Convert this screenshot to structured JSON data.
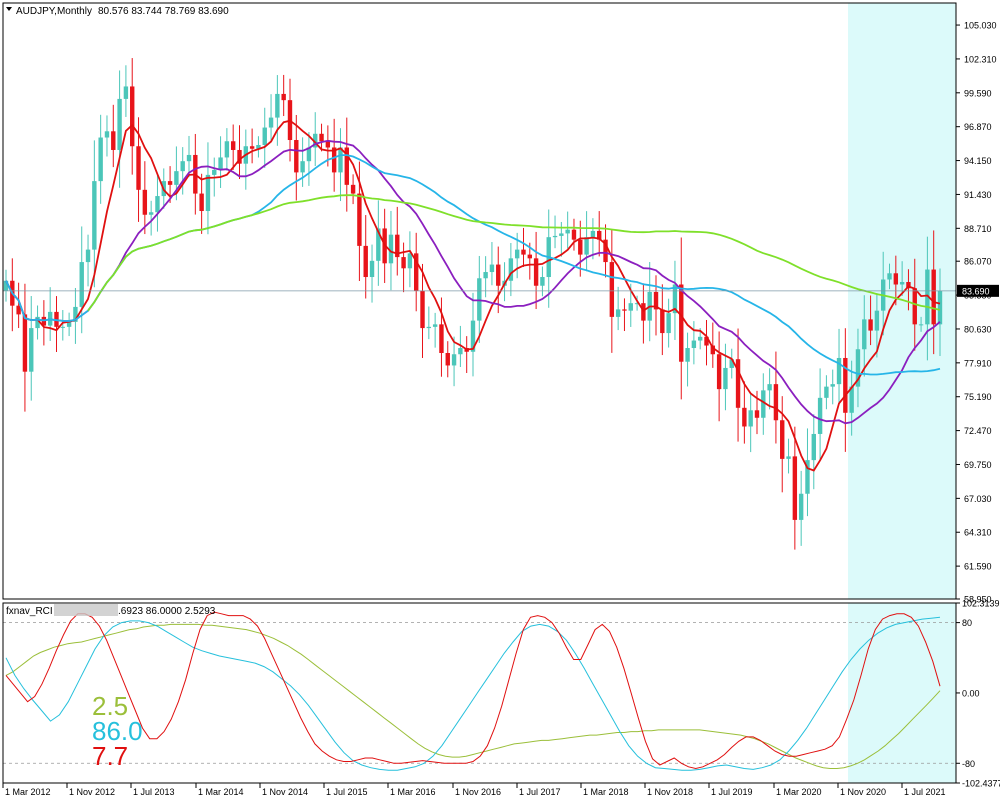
{
  "window": {
    "symbol_title": "AUDJPY,Monthly",
    "ohlc_text": "80.576 83.744 78.769 83.690",
    "indicator_label": "fxnav_RCI",
    "indicator_values_text": ".6923 86.0000 2.5293"
  },
  "colors": {
    "bull": "#4bc6b9",
    "bear": "#e8141a",
    "ma_fast": "#e01010",
    "ma_mid": "#8b1fbf",
    "ma_slow": "#26b5e8",
    "ma_long": "#7fe02a",
    "rci_short": "#e01010",
    "rci_mid": "#26c0dc",
    "rci_long": "#9bbf3a",
    "highlight": "#dcfafa",
    "current_line": "#7f9aa8"
  },
  "chart_data": [
    {
      "type": "candlestick",
      "title": "AUDJPY,Monthly",
      "ylim": [
        58.95,
        106.8
      ],
      "y_ticks": [
        "105.030",
        "102.310",
        "99.590",
        "96.870",
        "94.150",
        "91.430",
        "88.710",
        "86.070",
        "83.350",
        "80.630",
        "77.910",
        "75.190",
        "72.470",
        "69.750",
        "67.030",
        "64.310",
        "61.590",
        "58.950"
      ],
      "x_ticks": [
        "1 Mar 2012",
        "1 Nov 2012",
        "1 Jul 2013",
        "1 Mar 2014",
        "1 Nov 2014",
        "1 Jul 2015",
        "1 Mar 2016",
        "1 Nov 2016",
        "1 Jul 2017",
        "1 Mar 2018",
        "1 Nov 2018",
        "1 Jul 2019",
        "1 Mar 2020",
        "1 Nov 2020",
        "1 Jul 2021"
      ],
      "current_price": "83.690",
      "close": [
        84.5,
        82.5,
        81.8,
        77.2,
        80.7,
        81.6,
        80.9,
        82.0,
        80.8,
        80.8,
        81.2,
        82.4,
        86.0,
        87.0,
        92.5,
        96.0,
        96.5,
        95.0,
        99.1,
        100.1,
        95.3,
        91.8,
        89.8,
        90.0,
        91.3,
        92.5,
        92.2,
        93.3,
        94.1,
        94.6,
        91.5,
        90.1,
        93.0,
        93.4,
        94.4,
        95.7,
        95.0,
        93.9,
        95.3,
        95.1,
        95.4,
        96.8,
        97.6,
        99.5,
        99.0,
        95.8,
        93.2,
        94.1,
        95.2,
        96.3,
        95.7,
        95.2,
        93.2,
        95.2,
        92.2,
        91.5,
        87.3,
        84.8,
        86.1,
        88.7,
        85.9,
        88.2,
        86.4,
        85.5,
        86.7,
        83.7,
        80.7,
        80.8,
        81.0,
        78.7,
        77.7,
        78.6,
        79.1,
        78.8,
        81.3,
        84.7,
        85.2,
        85.8,
        84.1,
        84.5,
        86.3,
        87.0,
        86.6,
        86.3,
        84.1,
        84.8,
        88.0,
        88.1,
        88.3,
        88.6,
        87.8,
        86.6,
        88.0,
        88.5,
        87.8,
        86.0,
        81.6,
        82.2,
        82.1,
        82.7,
        82.7,
        81.3,
        83.6,
        82.2,
        80.3,
        81.9,
        84.2,
        78.0,
        79.1,
        79.7,
        80.0,
        79.3,
        78.6,
        75.8,
        77.5,
        78.2,
        74.3,
        72.8,
        74.1,
        73.5,
        75.7,
        76.2,
        73.3,
        70.2,
        70.4,
        65.3,
        67.4,
        70.1,
        72.2,
        75.1,
        76.0,
        76.2,
        78.3,
        73.9,
        76.0,
        79.0,
        81.4,
        80.5,
        82.1,
        84.6,
        85.1,
        84.2,
        84.4,
        83.9,
        81.0,
        81.0,
        85.4,
        81.0,
        83.69
      ],
      "note": "monthly candles from Feb 2012 to Nov 2021; values in JPY per AUD"
    },
    {
      "type": "line",
      "title": "fxnav_RCI",
      "ylim": [
        -102.4377,
        102.3139
      ],
      "y_ticks": [
        "102.3139",
        "80",
        "0.00",
        "-80",
        "-102.4377"
      ],
      "levels": [
        80,
        -80
      ],
      "series": [
        {
          "name": "2.5",
          "display": "2.5",
          "color_key": "rci_long",
          "values": [
            20,
            24,
            30,
            36,
            42,
            46,
            49,
            52,
            54,
            56,
            57,
            58,
            60,
            62,
            64,
            66,
            68,
            70,
            72,
            73,
            75,
            76,
            77,
            77,
            78,
            78,
            78,
            78,
            78,
            77,
            77,
            76,
            75,
            74,
            73,
            72,
            70,
            68,
            65,
            62,
            58,
            54,
            49,
            44,
            38,
            32,
            26,
            20,
            14,
            8,
            2,
            -4,
            -10,
            -16,
            -22,
            -28,
            -34,
            -40,
            -46,
            -52,
            -58,
            -63,
            -67,
            -70,
            -72,
            -73,
            -73,
            -72,
            -70,
            -68,
            -66,
            -64,
            -62,
            -60,
            -58,
            -57,
            -56,
            -55,
            -54,
            -54,
            -53,
            -52,
            -51,
            -50,
            -49,
            -48,
            -48,
            -47,
            -46,
            -45,
            -45,
            -44,
            -44,
            -43,
            -43,
            -42,
            -42,
            -42,
            -42,
            -42,
            -42,
            -42,
            -43,
            -44,
            -45,
            -46,
            -47,
            -48,
            -50,
            -52,
            -55,
            -58,
            -62,
            -66,
            -70,
            -74,
            -77,
            -80,
            -83,
            -85,
            -86,
            -86,
            -85,
            -83,
            -80,
            -76,
            -71,
            -66,
            -60,
            -53,
            -46,
            -38,
            -30,
            -22,
            -14,
            -6,
            2.5
          ]
        },
        {
          "name": "86.0",
          "display": "86.0",
          "color_key": "rci_mid",
          "values": [
            40,
            20,
            5,
            -8,
            -20,
            -32,
            -25,
            -10,
            10,
            30,
            50,
            65,
            75,
            80,
            82,
            82,
            80,
            76,
            70,
            64,
            58,
            52,
            48,
            45,
            42,
            40,
            38,
            36,
            34,
            30,
            24,
            16,
            8,
            -2,
            -14,
            -28,
            -42,
            -56,
            -68,
            -77,
            -82,
            -85,
            -87,
            -88,
            -88,
            -86,
            -84,
            -80,
            -72,
            -60,
            -45,
            -30,
            -15,
            0,
            15,
            30,
            45,
            58,
            70,
            76,
            78,
            76,
            70,
            60,
            45,
            28,
            10,
            -8,
            -26,
            -44,
            -60,
            -72,
            -80,
            -85,
            -86,
            -87,
            -88,
            -88,
            -87,
            -85,
            -83,
            -82,
            -84,
            -86,
            -87,
            -85,
            -82,
            -76,
            -66,
            -54,
            -40,
            -24,
            -8,
            8,
            24,
            38,
            50,
            60,
            68,
            74,
            78,
            80,
            82,
            84,
            85,
            86.0
          ]
        },
        {
          "name": "7.7",
          "display": "7.7",
          "color_key": "rci_short",
          "values": [
            20,
            10,
            0,
            -10,
            -4,
            10,
            28,
            48,
            66,
            82,
            90,
            90,
            86,
            76,
            60,
            40,
            20,
            0,
            -20,
            -40,
            -52,
            -52,
            -44,
            -30,
            -10,
            15,
            45,
            72,
            88,
            92,
            90,
            88,
            88,
            88,
            84,
            76,
            62,
            44,
            26,
            8,
            -10,
            -28,
            -44,
            -58,
            -66,
            -72,
            -76,
            -78,
            -78,
            -76,
            -74,
            -74,
            -76,
            -78,
            -80,
            -80,
            -79,
            -78,
            -77,
            -78,
            -79,
            -80,
            -80,
            -80,
            -80,
            -78,
            -72,
            -60,
            -40,
            -15,
            15,
            45,
            72,
            86,
            88,
            86,
            80,
            68,
            52,
            38,
            38,
            55,
            72,
            78,
            70,
            52,
            28,
            0,
            -28,
            -55,
            -75,
            -82,
            -78,
            -74,
            -80,
            -84,
            -86,
            -84,
            -80,
            -76,
            -70,
            -62,
            -55,
            -50,
            -50,
            -54,
            -60,
            -66,
            -70,
            -72,
            -72,
            -70,
            -68,
            -66,
            -64,
            -60,
            -50,
            -30,
            -8,
            20,
            50,
            72,
            84,
            88,
            90,
            90,
            86,
            76,
            58,
            36,
            7.7
          ]
        }
      ]
    }
  ]
}
